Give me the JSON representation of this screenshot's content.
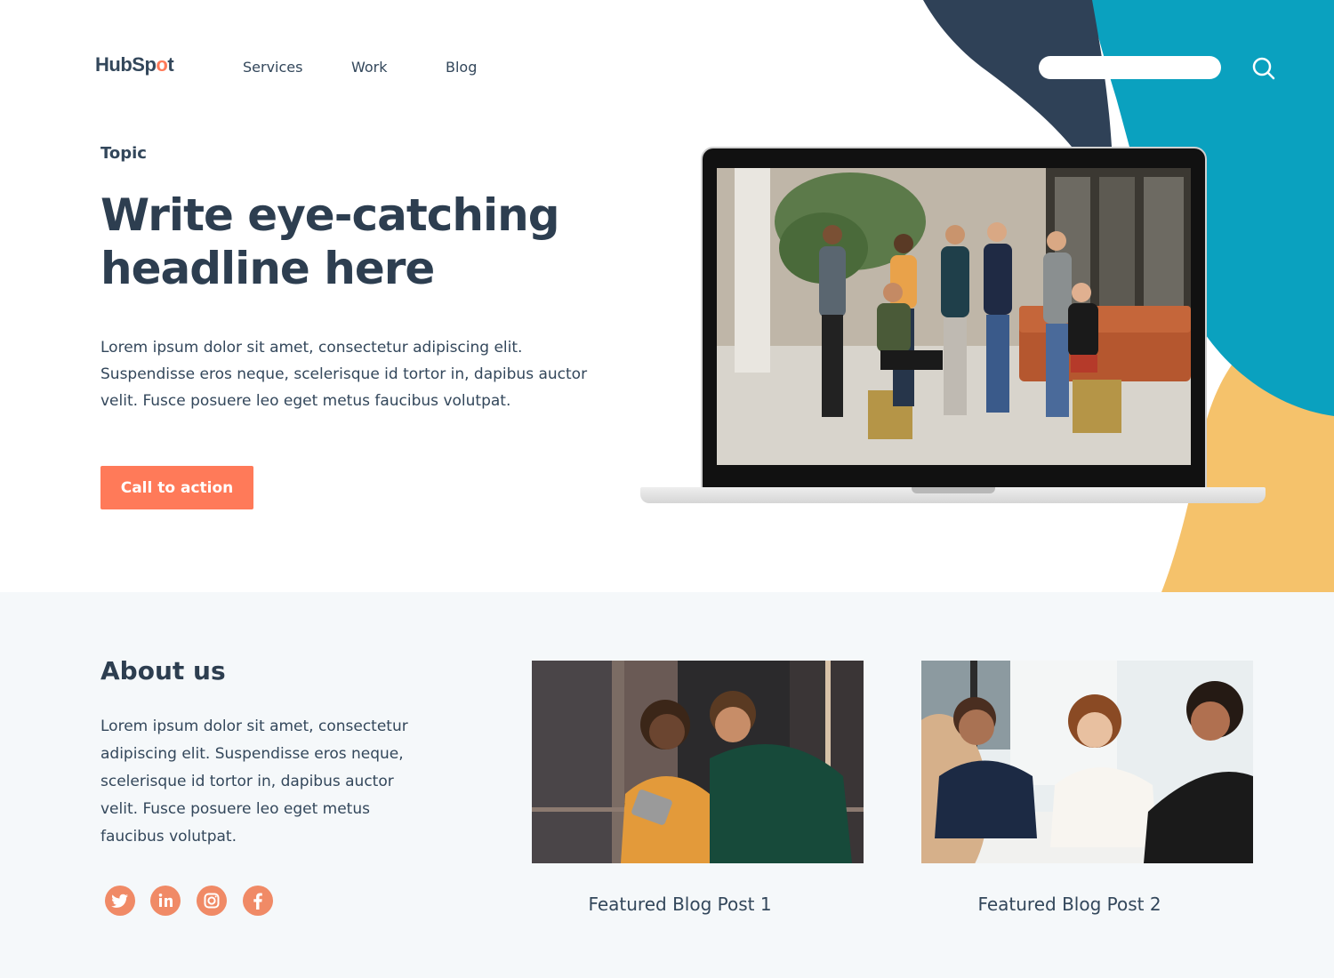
{
  "header": {
    "logo": {
      "part1": "HubSp",
      "part2": "o",
      "part3": "t"
    },
    "nav": [
      {
        "label": "Services"
      },
      {
        "label": "Work"
      },
      {
        "label": "Blog"
      }
    ],
    "search": {
      "value": "",
      "icon": "search-icon"
    }
  },
  "hero": {
    "topic": "Topic",
    "headline": "Write eye-catching headline here",
    "body": "Lorem ipsum dolor sit amet, consectetur adipiscing elit. Suspendisse eros neque, scelerisque id tortor in, dapibus auctor velit. Fusce posuere leo eget metus faucibus volutpat.",
    "cta_label": "Call to action"
  },
  "about": {
    "title": "About us",
    "body": "Lorem ipsum dolor sit amet, consectetur adipiscing elit. Suspendisse eros neque, scelerisque id tortor in, dapibus auctor velit. Fusce posuere leo eget metus faucibus volutpat.",
    "social": [
      {
        "icon": "twitter-icon"
      },
      {
        "icon": "linkedin-icon"
      },
      {
        "icon": "instagram-icon"
      },
      {
        "icon": "facebook-icon"
      }
    ]
  },
  "posts": [
    {
      "title": "Featured Blog Post 1"
    },
    {
      "title": "Featured Blog Post 2"
    }
  ],
  "colors": {
    "accent": "#ff7a59",
    "navy": "#33475b",
    "teal": "#0aa1bf",
    "yellow": "#f5c26b",
    "dark_blob": "#2f4157",
    "section_bg": "#f5f8fa"
  }
}
